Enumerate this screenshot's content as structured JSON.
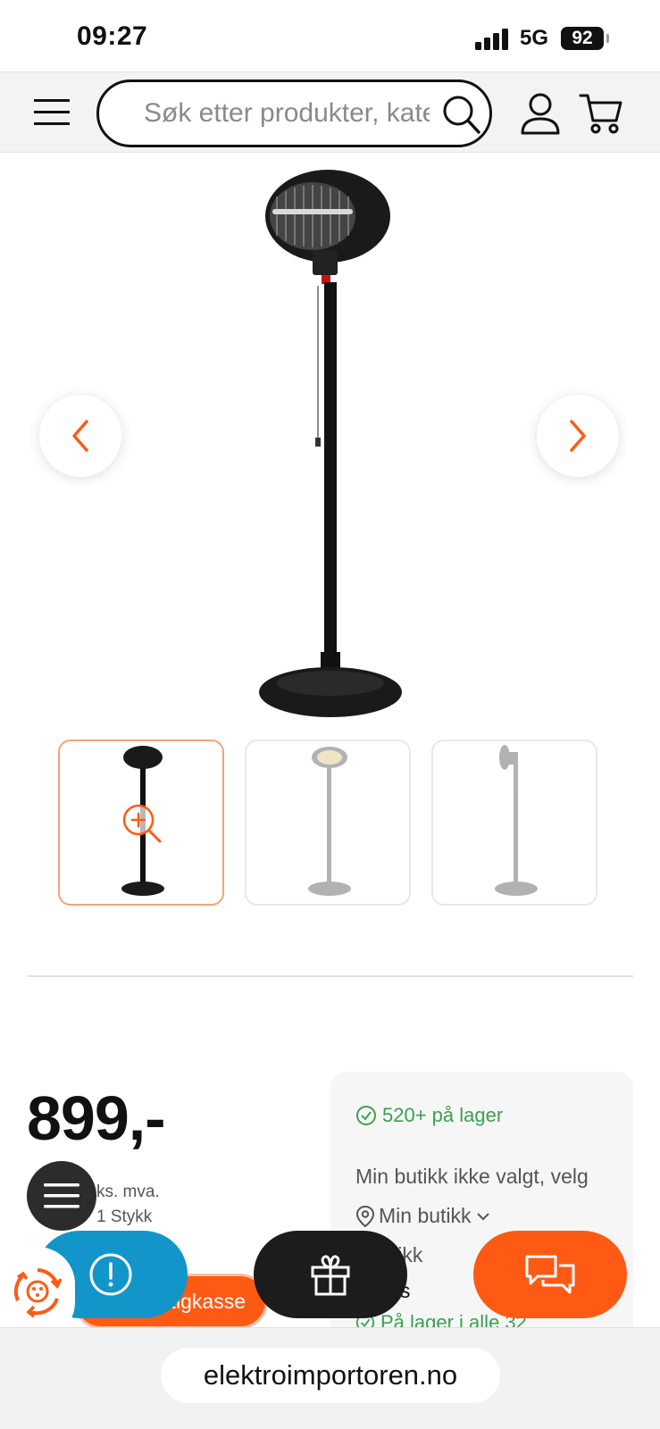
{
  "status_bar": {
    "time": "09:27",
    "network": "5G",
    "battery": "92"
  },
  "header": {
    "search_placeholder": "Søk etter produkter, kategorier"
  },
  "product": {
    "price": "899,-",
    "vat_note": "ks. mva.",
    "unit_note": "1 Stykk",
    "checkout_label": "tigkasse"
  },
  "stock": {
    "stock_status": "520+ på lager",
    "store_prompt": "Min butikk ikke valgt, velg",
    "store_select": "Min butikk",
    "store_name": "i-Butikk",
    "status_label": "status",
    "all_stores": "På lager i alle 32"
  },
  "browser": {
    "url": "elektroimportoren.no"
  },
  "colors": {
    "accent": "#ff5a14",
    "stock_green": "#3aa14f",
    "info_blue": "#1296c9"
  }
}
